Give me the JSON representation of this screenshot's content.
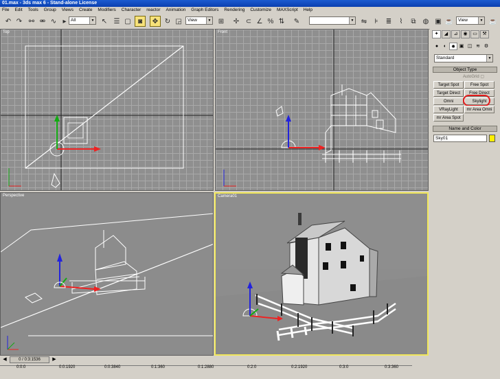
{
  "window": {
    "title": "01.max - 3ds max 6 - Stand-alone License"
  },
  "menu": [
    "File",
    "Edit",
    "Tools",
    "Group",
    "Views",
    "Create",
    "Modifiers",
    "Character",
    "reactor",
    "Animation",
    "Graph Editors",
    "Rendering",
    "Customize",
    "MAXScript",
    "Help"
  ],
  "toolbar": {
    "selection_filter": "All",
    "ref_coord": "View",
    "named_sets": "",
    "view_right": "View"
  },
  "viewports": {
    "top": "Top",
    "front": "Front",
    "perspective": "Perspective",
    "camera": "Camera01"
  },
  "command_panel": {
    "category": "Standard",
    "object_type": {
      "header": "Object Type",
      "autogrid": "AutoGrid",
      "buttons": [
        "Target Spot",
        "Free Spot",
        "Target Direct",
        "Free Direct",
        "Omni",
        "Skylight",
        "VRayLight",
        "mr Area Omni",
        "mr Area Spot"
      ]
    },
    "name_and_color": {
      "header": "Name and Color",
      "name": "Sky01",
      "color": "#ffee00"
    }
  },
  "timeline": {
    "slider": "0 / 0:3:1536",
    "ticks": [
      "0:0:0",
      "0:0:1920",
      "0:0:3840",
      "0:1:360",
      "0:1:2880",
      "0:2:0",
      "0:2:1920",
      "0:3:0",
      "0:3:360"
    ]
  },
  "colors": {
    "active_viewport": "#f1e75a",
    "highlight": "#e21b1b",
    "viewport_bg": "#8f8f8f"
  }
}
